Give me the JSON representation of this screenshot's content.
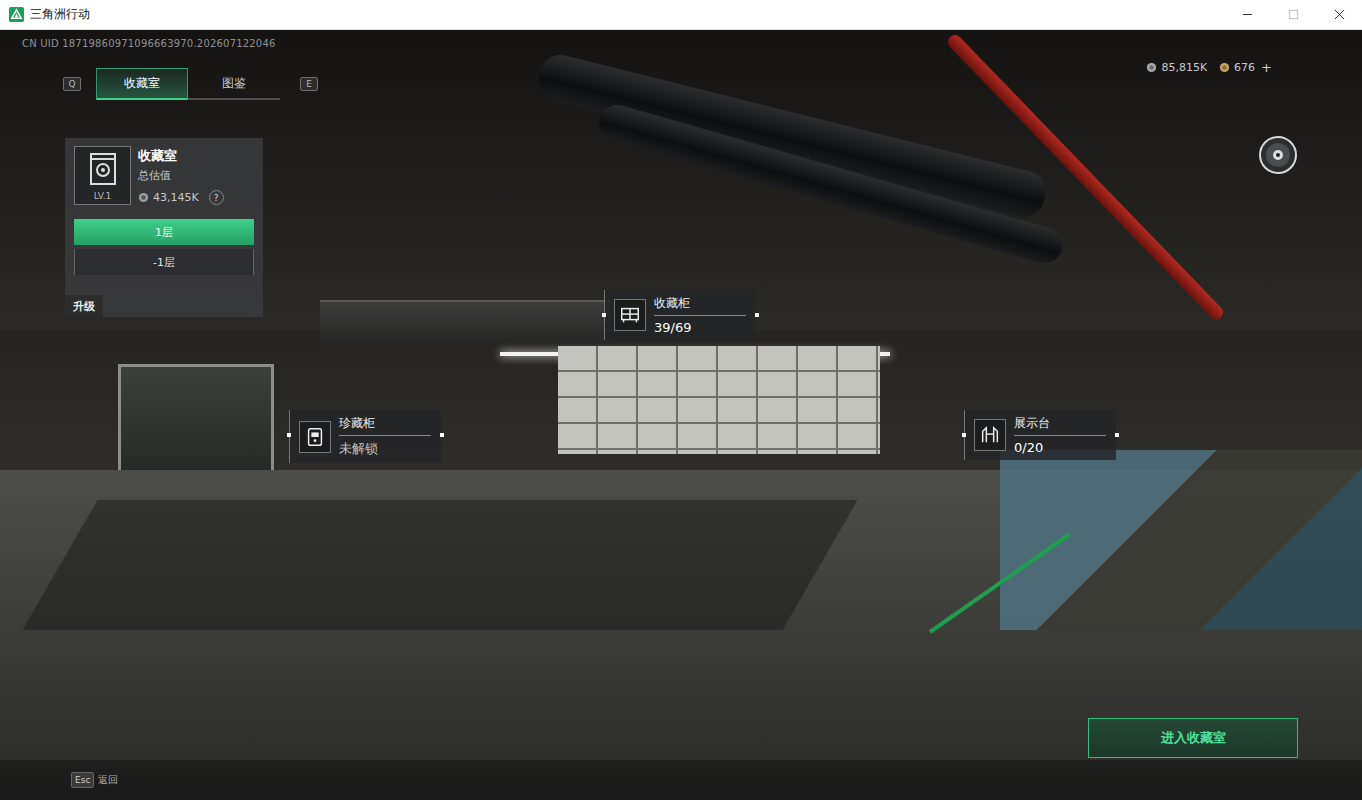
{
  "window": {
    "title": "三角洲行动"
  },
  "uid": "CN UID 18719860971096663970.202607122046",
  "tabs": {
    "prev_key": "Q",
    "next_key": "E",
    "items": [
      {
        "label": "收藏室",
        "selected": true
      },
      {
        "label": "图鉴",
        "selected": false
      }
    ]
  },
  "currency": [
    {
      "value": "85,815K"
    },
    {
      "value": "676"
    }
  ],
  "currency_add": "+",
  "room_panel": {
    "title": "收藏室",
    "subtitle": "总估值",
    "level": "LV.1",
    "value": "43,145K",
    "help": "?",
    "floors": [
      {
        "label": "1层",
        "selected": true
      },
      {
        "label": "-1层",
        "selected": false
      }
    ],
    "upgrade": "升级"
  },
  "hotspots": [
    {
      "title": "收藏柜",
      "status": "39/69",
      "locked": false
    },
    {
      "title": "珍藏柜",
      "status": "未解锁",
      "locked": true
    },
    {
      "title": "展示台",
      "status": "0/20",
      "locked": false
    }
  ],
  "enter_button": "进入收藏室",
  "footer": {
    "key": "Esc",
    "label": "返回"
  }
}
